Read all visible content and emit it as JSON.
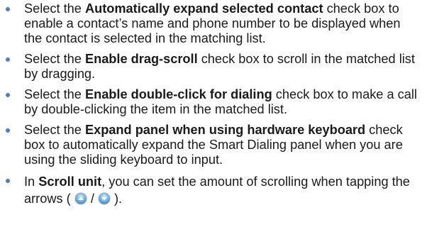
{
  "bullets": [
    {
      "pre": "Select the ",
      "bold": "Automatically expand selected contact",
      "post": " check box to enable a contact’s name and phone number to be displayed when the contact is selected in the matching list."
    },
    {
      "pre": "Select the ",
      "bold": "Enable drag-scroll",
      "post": " check box to scroll in the matched list by dragging."
    },
    {
      "pre": "Select the ",
      "bold": "Enable double-click for dialing",
      "post": " check box to make a call by double-clicking the item in the matched list."
    },
    {
      "pre": "Select the ",
      "bold": "Expand panel when using hardware keyboard",
      "post": " check box to automatically expand the Smart Dialing panel when you are using the sliding keyboard to input."
    },
    {
      "pre": "In ",
      "bold": "Scroll unit",
      "post": ", you can set the amount of scrolling when tapping the arrows (",
      "separator": "/",
      "end": ")."
    }
  ],
  "colors": {
    "bullet": "#4a7fc1",
    "text": "#1a1a1a",
    "arrow_fill": "#5aa8e0"
  },
  "icons": {
    "arrow_up": "arrow-up-icon",
    "arrow_down": "arrow-down-icon"
  }
}
